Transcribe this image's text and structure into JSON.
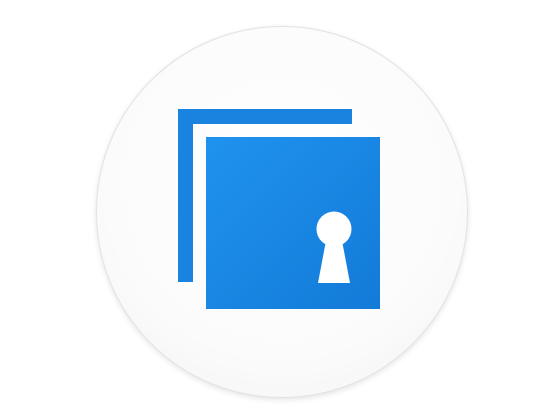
{
  "icon": {
    "name": "secure-folder-lock-icon",
    "colors": {
      "primary": "#1a8ae6",
      "secondary": "#0f6fca",
      "keyhole": "#ffffff",
      "background": "#ffffff"
    }
  }
}
